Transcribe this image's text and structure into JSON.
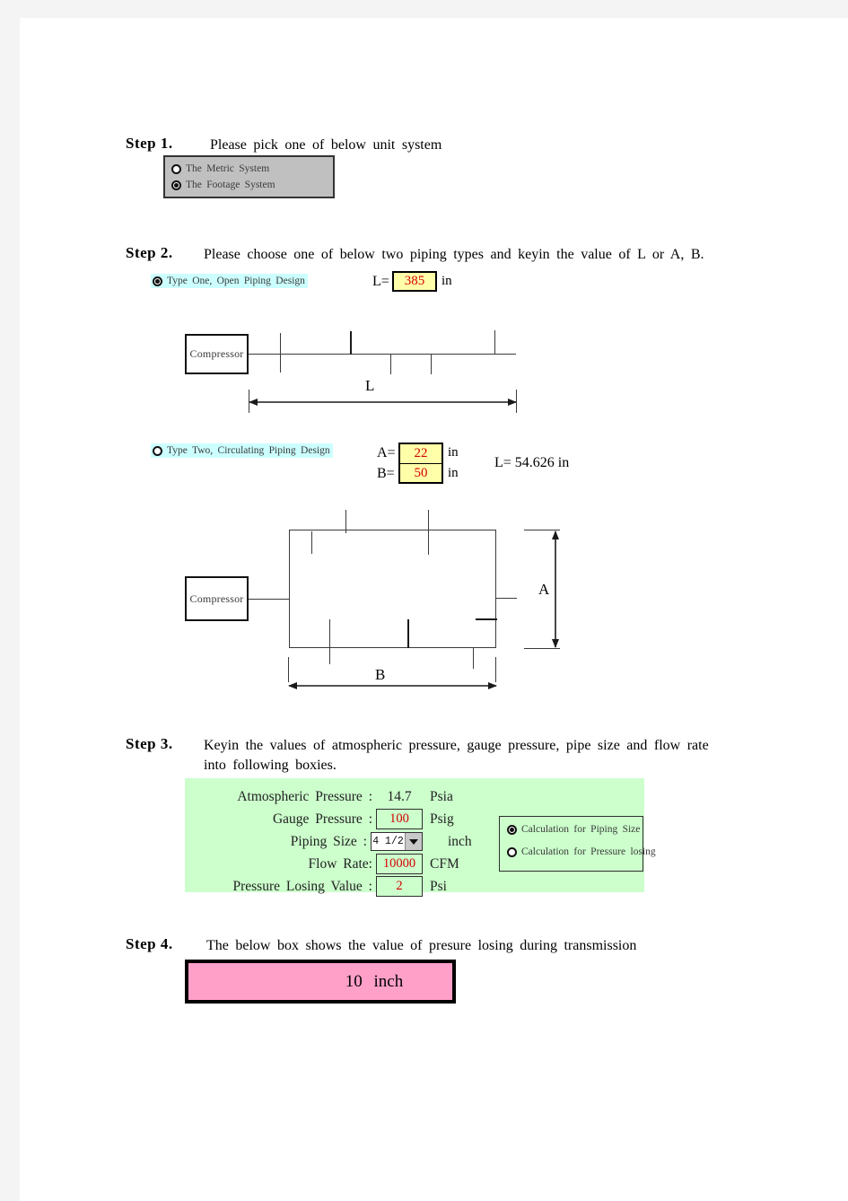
{
  "steps": {
    "s1": {
      "label": "Step 1.",
      "text": "Please pick one of below unit system"
    },
    "s2": {
      "label": "Step 2.",
      "text": "Please choose one of below two piping types and keyin the value of L or A, B."
    },
    "s3": {
      "label": "Step 3.",
      "line1": "Keyin the values of atmospheric pressure, gauge pressure, pipe size and flow rate",
      "line2": "into following boxies."
    },
    "s4": {
      "label": "Step 4.",
      "text": "The below box shows the value of presure losing during transmission"
    }
  },
  "unit_system": {
    "metric": "The Metric System",
    "footage": "The Footage System",
    "selected": "footage"
  },
  "piping_type": {
    "type_one": "Type One,  Open Piping Design",
    "type_two": "Type Two, Circulating Piping Design",
    "selected": "type_one"
  },
  "type_one": {
    "l_label": "L=",
    "l_value": "385",
    "l_unit": "in",
    "compressor": "Compressor",
    "dim_letter": "L"
  },
  "type_two": {
    "a_label": "A=",
    "a_value": "22",
    "a_unit": "in",
    "b_label": "B=",
    "b_value": "50",
    "b_unit": "in",
    "l_result": "L=  54.626   in",
    "compressor": "Compressor",
    "dim_a": "A",
    "dim_b": "B"
  },
  "inputs": {
    "atmospheric": {
      "name": "Atmospheric  Pressure  :",
      "value": "14.7",
      "unit": "Psia"
    },
    "gauge": {
      "name": "Gauge  Pressure  :",
      "value": "100",
      "unit": "Psig"
    },
    "piping_size": {
      "name": "Piping  Size  :",
      "value": "4 1/2",
      "unit": "inch"
    },
    "flow_rate": {
      "name": "Flow  Rate:",
      "value": "10000",
      "unit": "CFM"
    },
    "pressure_losing": {
      "name": "Pressure  Losing  Value  :",
      "value": "2",
      "unit": "Psi"
    }
  },
  "calc_mode": {
    "piping_size": "Calculation  for  Piping Size",
    "pressure_losing": "Calculation  for  Pressure losing",
    "selected": "piping_size"
  },
  "result": {
    "value": "10",
    "unit": "inch"
  },
  "colors": {
    "yellow_input": "#ffffaa",
    "green_panel": "#ccffcc",
    "pink_result": "#ffa0c8",
    "cyan_highlight": "#ccffff",
    "gray_panel": "#c0c0c0",
    "value_red": "#d40000"
  }
}
